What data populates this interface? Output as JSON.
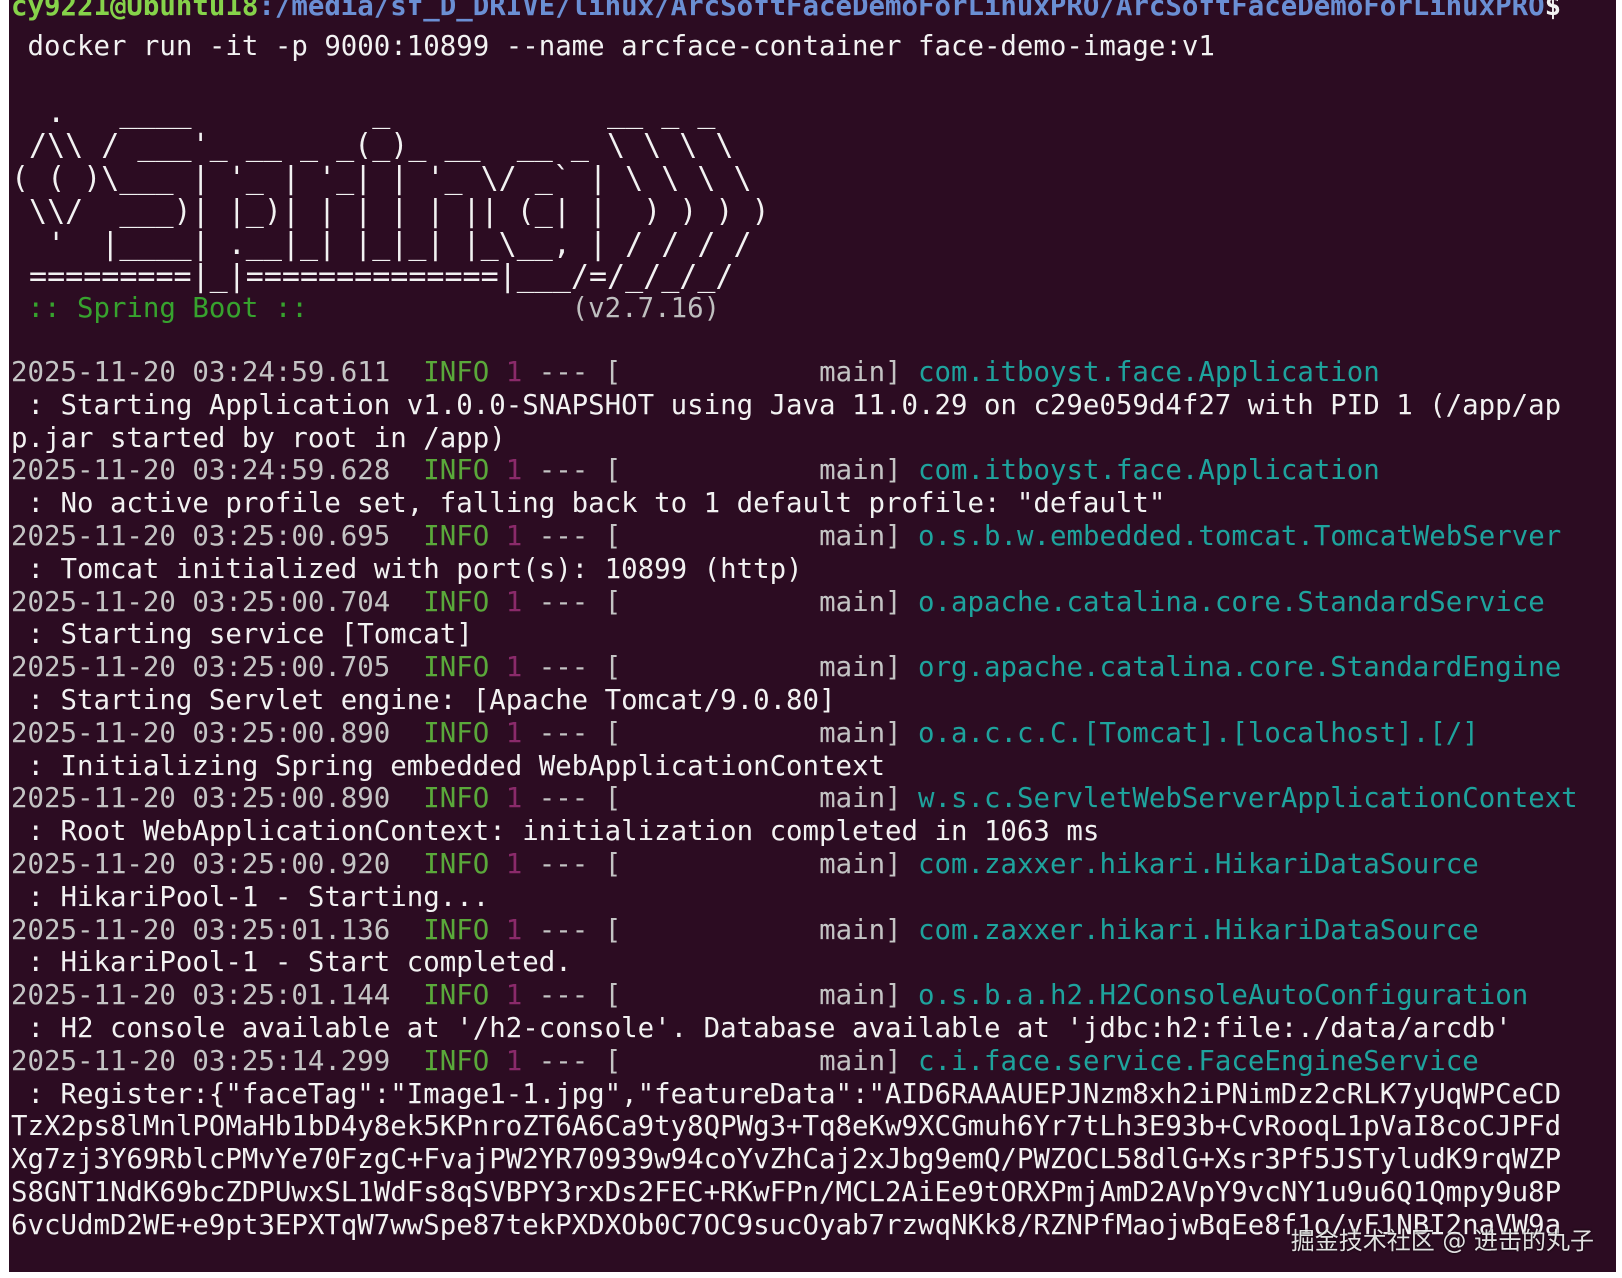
{
  "terminal": {
    "prompt": {
      "user_host": "cy9221@Ubuntu18",
      "path": ":/media/sf_D_DRIVE/linux/ArcSoftFaceDemoForLinuxPRO/ArcSoftFaceDemoForLinuxPRO",
      "symbol": "$"
    },
    "command": " docker run -it -p 9000:10899 --name arcface-container face-demo-image:v1",
    "banner": [
      "  .   ____          _            __ _ _",
      " /\\\\ / ___'_ __ _ _(_)_ __  __ _ \\ \\ \\ \\",
      "( ( )\\___ | '_ | '_| | '_ \\/ _` | \\ \\ \\ \\",
      " \\\\/  ___)| |_)| | | | | || (_| |  ) ) ) )",
      "  '  |____| .__|_| |_|_| |_\\__, | / / / /",
      " =========|_|==============|___/=/_/_/_/"
    ],
    "boot_label": " :: Spring Boot :: ",
    "boot_version": "               (v2.7.16)",
    "log_entries": [
      {
        "timestamp": "2025-11-20 03:24:59.611",
        "level": "INFO",
        "pid": "1",
        "sep": "--- [",
        "thread": "main]",
        "logger": "com.itboyst.face.Application",
        "message": [
          " : Starting Application v1.0.0-SNAPSHOT using Java 11.0.29 on c29e059d4f27 with PID 1 (/app/ap",
          "p.jar started by root in /app)"
        ]
      },
      {
        "timestamp": "2025-11-20 03:24:59.628",
        "level": "INFO",
        "pid": "1",
        "sep": "--- [",
        "thread": "main]",
        "logger": "com.itboyst.face.Application",
        "message": [
          " : No active profile set, falling back to 1 default profile: \"default\""
        ]
      },
      {
        "timestamp": "2025-11-20 03:25:00.695",
        "level": "INFO",
        "pid": "1",
        "sep": "--- [",
        "thread": "main]",
        "logger": "o.s.b.w.embedded.tomcat.TomcatWebServer",
        "message": [
          " : Tomcat initialized with port(s): 10899 (http)"
        ]
      },
      {
        "timestamp": "2025-11-20 03:25:00.704",
        "level": "INFO",
        "pid": "1",
        "sep": "--- [",
        "thread": "main]",
        "logger": "o.apache.catalina.core.StandardService",
        "message": [
          " : Starting service [Tomcat]"
        ]
      },
      {
        "timestamp": "2025-11-20 03:25:00.705",
        "level": "INFO",
        "pid": "1",
        "sep": "--- [",
        "thread": "main]",
        "logger": "org.apache.catalina.core.StandardEngine",
        "message": [
          " : Starting Servlet engine: [Apache Tomcat/9.0.80]"
        ]
      },
      {
        "timestamp": "2025-11-20 03:25:00.890",
        "level": "INFO",
        "pid": "1",
        "sep": "--- [",
        "thread": "main]",
        "logger": "o.a.c.c.C.[Tomcat].[localhost].[/]",
        "message": [
          " : Initializing Spring embedded WebApplicationContext"
        ]
      },
      {
        "timestamp": "2025-11-20 03:25:00.890",
        "level": "INFO",
        "pid": "1",
        "sep": "--- [",
        "thread": "main]",
        "logger": "w.s.c.ServletWebServerApplicationContext",
        "message": [
          " : Root WebApplicationContext: initialization completed in 1063 ms"
        ]
      },
      {
        "timestamp": "2025-11-20 03:25:00.920",
        "level": "INFO",
        "pid": "1",
        "sep": "--- [",
        "thread": "main]",
        "logger": "com.zaxxer.hikari.HikariDataSource",
        "message": [
          " : HikariPool-1 - Starting..."
        ]
      },
      {
        "timestamp": "2025-11-20 03:25:01.136",
        "level": "INFO",
        "pid": "1",
        "sep": "--- [",
        "thread": "main]",
        "logger": "com.zaxxer.hikari.HikariDataSource",
        "message": [
          " : HikariPool-1 - Start completed."
        ]
      },
      {
        "timestamp": "2025-11-20 03:25:01.144",
        "level": "INFO",
        "pid": "1",
        "sep": "--- [",
        "thread": "main]",
        "logger": "o.s.b.a.h2.H2ConsoleAutoConfiguration",
        "message": [
          " : H2 console available at '/h2-console'. Database available at 'jdbc:h2:file:./data/arcdb'"
        ]
      },
      {
        "timestamp": "2025-11-20 03:25:14.299",
        "level": "INFO",
        "pid": "1",
        "sep": "--- [",
        "thread": "main]",
        "logger": "c.i.face.service.FaceEngineService",
        "message": [
          " : Register:{\"faceTag\":\"Image1-1.jpg\",\"featureData\":\"AID6RAAAUEPJNzm8xh2iPNimDz2cRLK7yUqWPCeCD",
          "TzX2ps8lMnlPOMaHb1bD4y8ek5KPnroZT6A6Ca9ty8QPWg3+Tq8eKw9XCGmuh6Yr7tLh3E93b+CvRooqL1pVaI8coCJPFd",
          "Xg7zj3Y69RblcPMvYe70FzgC+FvajPW2YR70939w94coYvZhCaj2xJbg9emQ/PWZOCL58dlG+Xsr3Pf5JSTyludK9rqWZP",
          "S8GNT1NdK69bcZDPUwxSL1WdFs8qSVBPY3rxDs2FEC+RKwFPn/MCL2AiEe9tORXPmjAmD2AVpY9vcNY1u9u6Q1Qmpy9u8P",
          "6vcUdmD2WE+e9pt3EPXTqW7wwSpe87tekPXDXOb0C7OC9sucOyab7rzwqNKk8/RZNPfMaojwBqEe8f1o/vF1NBI2naVW9a"
        ]
      }
    ]
  },
  "watermark": "掘金技术社区 @ 进击的丸子"
}
